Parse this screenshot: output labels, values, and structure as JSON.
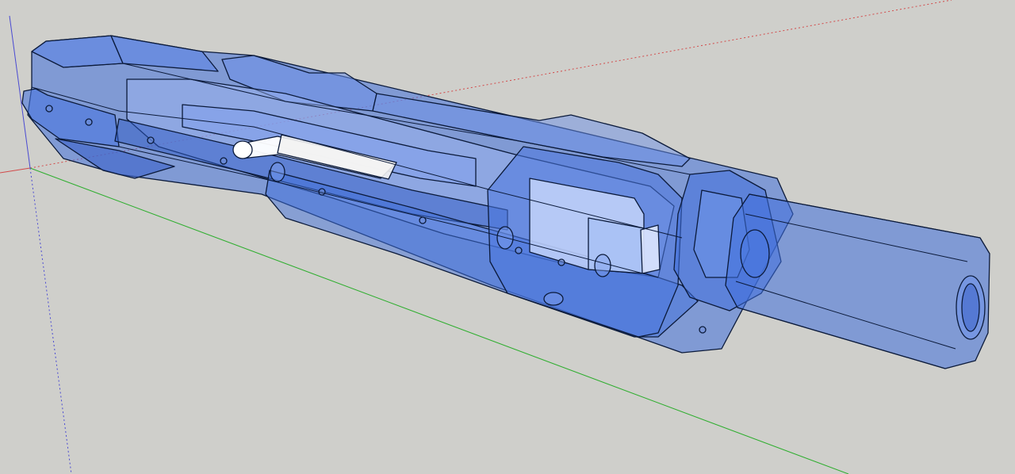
{
  "viewport": {
    "background": "#cfcfcb"
  },
  "axes": {
    "red_color": "#d24a4a",
    "green_color": "#2fae2f",
    "blue_color": "#4b4bd2"
  },
  "model": {
    "shell_fill": "#3f6fdc",
    "shell_stroke": "#0b1a3a",
    "inner_fill": "#9fb9f3",
    "highlight_fill": "#c9d8fb",
    "rod_fill": "#ffffff"
  }
}
